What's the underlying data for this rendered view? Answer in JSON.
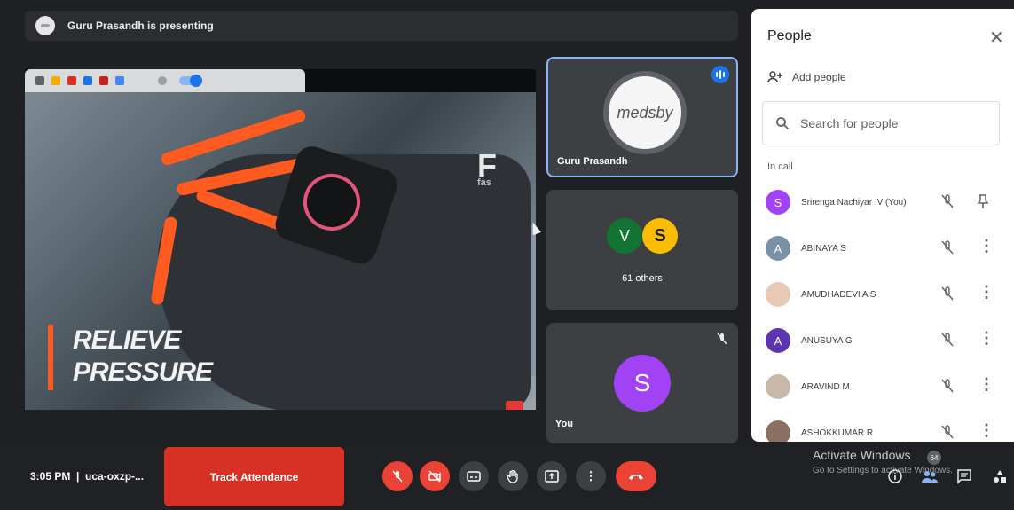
{
  "banner": {
    "presenter_text": "Guru Prasandh is presenting"
  },
  "shared_video": {
    "headline_line1": "RELIEVE",
    "headline_line2": "PRESSURE",
    "brand_logo_letter": "F",
    "brand_logo_text": "fas"
  },
  "tiles": {
    "presenter": {
      "name": "Guru Prasandh",
      "logo_text": "medsby"
    },
    "others": {
      "avatar1_letter": "V",
      "avatar2_letter": "S",
      "label": "61 others"
    },
    "self": {
      "avatar_letter": "S",
      "name": "You"
    }
  },
  "people_panel": {
    "title": "People",
    "close_glyph": "✕",
    "add_people": "Add people",
    "search_placeholder": "Search for people",
    "section_label": "In call",
    "participants": [
      {
        "initial": "S",
        "name": "Srirenga Nachiyar .V (You)",
        "color": "#a142f4",
        "action": "pin"
      },
      {
        "initial": "A",
        "name": "ABINAYA S",
        "color": "#7b8fa6",
        "action": "more"
      },
      {
        "initial": "",
        "name": "AMUDHADEVI A S",
        "color": "#e8c9b5",
        "action": "more"
      },
      {
        "initial": "A",
        "name": "ANUSUYA G",
        "color": "#5e35b1",
        "action": "more"
      },
      {
        "initial": "",
        "name": "ARAVIND M",
        "color": "#c9b8a8",
        "action": "more"
      },
      {
        "initial": "",
        "name": "ASHOKKUMAR R",
        "color": "#8d6e63",
        "action": "more"
      }
    ]
  },
  "bottom_bar": {
    "meeting_info": "3:05 PM  |  uca-oxzp-...",
    "track_attendance": "Track Attendance",
    "activate_title": "Activate Windows",
    "activate_sub": "Go to Settings to activate Windows.",
    "participant_count": "64"
  }
}
